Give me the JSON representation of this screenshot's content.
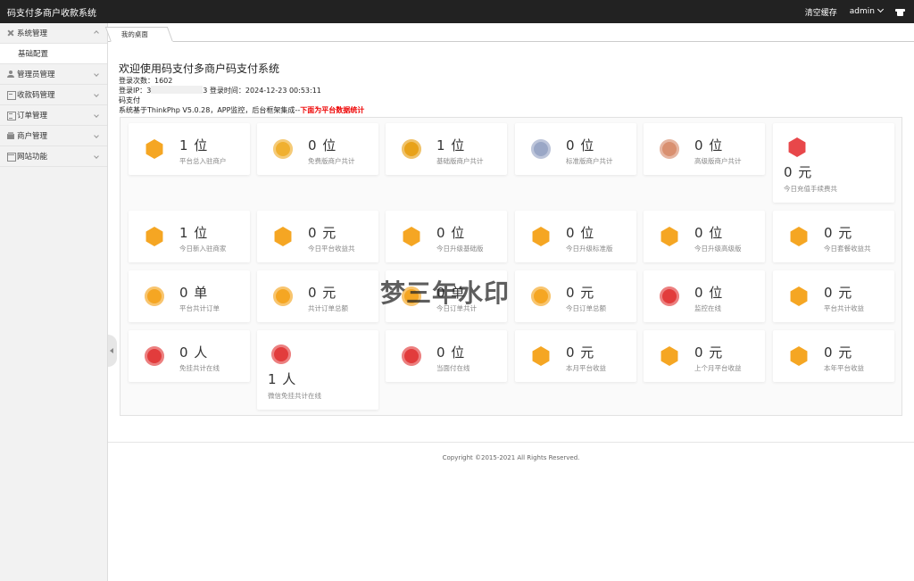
{
  "header": {
    "brand": "码支付多商户收款系统",
    "clear_cache": "清空缓存",
    "user": "admin",
    "shirt_icon": "shirt-icon"
  },
  "sidebar": {
    "items": [
      {
        "label": "系统管理",
        "icon": "tools-icon",
        "expanded": true,
        "sub": [
          "基础配置"
        ]
      },
      {
        "label": "管理员管理",
        "icon": "user-icon"
      },
      {
        "label": "收款码管理",
        "icon": "box-icon"
      },
      {
        "label": "订单管理",
        "icon": "list-icon"
      },
      {
        "label": "商户管理",
        "icon": "shop-icon"
      },
      {
        "label": "网站功能",
        "icon": "web-icon"
      }
    ]
  },
  "tabs": [
    {
      "label": "我的桌面"
    }
  ],
  "welcome": {
    "title": "欢迎使用码支付多商户码支付系统",
    "login_count_label": "登录次数：",
    "login_count": "1602",
    "login_ip_label": "登录IP：",
    "login_ip_prefix": "3",
    "login_ip_suffix": "3",
    "login_time_label": "登录时间：",
    "login_time": "2024-12-23 00:53:11",
    "line3": "码支付",
    "line4": "系统基于ThinkPhp V5.0.28，APP监控，后台框架集成--",
    "line4_red": "下面为平台数据统计"
  },
  "stats": [
    {
      "value": "1 位",
      "label": "平台总入驻商户",
      "badge": "gold-shield-icon",
      "color": "#f5a623"
    },
    {
      "value": "0 位",
      "label": "免费版商户共计",
      "badge": "gold-medal-icon",
      "color": "#f0b030"
    },
    {
      "value": "1 位",
      "label": "基础版商户共计",
      "badge": "ribbon-badge-icon",
      "color": "#e8a21a"
    },
    {
      "value": "0 位",
      "label": "标准版商户共计",
      "badge": "silver-badge-icon",
      "color": "#9aa7c6"
    },
    {
      "value": "0 位",
      "label": "高级版商户共计",
      "badge": "bronze-badge-icon",
      "color": "#d99070"
    },
    {
      "value": "0 元",
      "label": "今日充值手续费共",
      "badge": "red-hex-icon",
      "color": "#e8474a"
    },
    {
      "value": "1 位",
      "label": "今日新入驻商家",
      "badge": "gold-shield-icon",
      "color": "#f5a623"
    },
    {
      "value": "0 元",
      "label": "今日平台收益共",
      "badge": "gold-hex-icon",
      "color": "#f5a623"
    },
    {
      "value": "0 位",
      "label": "今日升级基础版",
      "badge": "vip-hex-icon",
      "color": "#f5a623"
    },
    {
      "value": "0 位",
      "label": "今日升级标准版",
      "badge": "vip-hex-icon",
      "color": "#f5a623"
    },
    {
      "value": "0 位",
      "label": "今日升级高级版",
      "badge": "vip-hex-icon",
      "color": "#f5a623"
    },
    {
      "value": "0 元",
      "label": "今日套餐收益共",
      "badge": "gold-hex-icon",
      "color": "#f5a623"
    },
    {
      "value": "0 单",
      "label": "平台共计订单",
      "badge": "gold-medal-icon",
      "color": "#f5a623"
    },
    {
      "value": "0 元",
      "label": "共计订单总额",
      "badge": "gold-medal-icon",
      "color": "#f5a623"
    },
    {
      "value": "0 单",
      "label": "今日订单共计",
      "badge": "gold-medal-icon",
      "color": "#f5a623"
    },
    {
      "value": "0 元",
      "label": "今日订单总额",
      "badge": "gold-medal-icon",
      "color": "#f5a623"
    },
    {
      "value": "0 位",
      "label": "监控在线",
      "badge": "red-medal-icon",
      "color": "#e23c3c"
    },
    {
      "value": "0 元",
      "label": "平台共计收益",
      "badge": "gold-hex-icon",
      "color": "#f5a623"
    },
    {
      "value": "0 人",
      "label": "免挂共计在线",
      "badge": "red-medal-icon",
      "color": "#e23c3c"
    },
    {
      "value": "1 人",
      "label": "微信免挂共计在线",
      "badge": "red-medal-icon",
      "color": "#e23c3c"
    },
    {
      "value": "0 位",
      "label": "当面付在线",
      "badge": "red-medal-icon",
      "color": "#e23c3c"
    },
    {
      "value": "0 元",
      "label": "本月平台收益",
      "badge": "gold-hex-icon",
      "color": "#f5a623"
    },
    {
      "value": "0 元",
      "label": "上个月平台收益",
      "badge": "gold-hex-icon",
      "color": "#f5a623"
    },
    {
      "value": "0 元",
      "label": "本年平台收益",
      "badge": "gold-hex-icon",
      "color": "#f5a623"
    }
  ],
  "footer": "Copyright ©2015-2021 All Rights Reserved.",
  "watermark": "梦三年水印"
}
